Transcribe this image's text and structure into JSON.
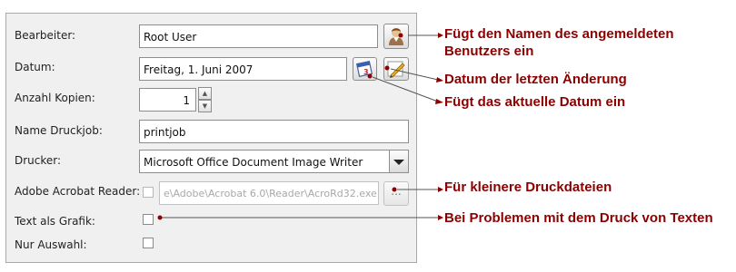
{
  "form": {
    "bearbeiter": {
      "label": "Bearbeiter:",
      "value": "Root User"
    },
    "datum": {
      "label": "Datum:",
      "value": "Freitag, 1. Juni 2007",
      "calendar_badge": "3"
    },
    "kopien": {
      "label": "Anzahl Kopien:",
      "value": "1"
    },
    "druckjob": {
      "label": "Name Druckjob:",
      "value": "printjob"
    },
    "drucker": {
      "label": "Drucker:",
      "value": "Microsoft Office Document Image Writer"
    },
    "acrobat": {
      "label": "Adobe Acrobat Reader:",
      "value": "e\\Adobe\\Acrobat 6.0\\Reader\\AcroRd32.exe",
      "browse_label": "..."
    },
    "text_als_grafik": {
      "label": "Text als Grafik:"
    },
    "nur_auswahl": {
      "label": "Nur Auswahl:"
    }
  },
  "annotations": {
    "user_button": "Fügt den Namen des angemeldeten Benutzers ein",
    "last_change": "Datum der letzten Änderung",
    "current_date": "Fügt das aktuelle Datum ein",
    "small_files": "Für kleinere Druckdateien",
    "text_problems": "Bei Problemen mit dem Druck von Texten"
  },
  "colors": {
    "annotation": "#8b0000",
    "panel": "#f0f0f0"
  },
  "icons": [
    "user-icon",
    "calendar-icon",
    "edit-pencil-icon",
    "chevron-down-icon",
    "spin-up-icon",
    "spin-down-icon"
  ]
}
